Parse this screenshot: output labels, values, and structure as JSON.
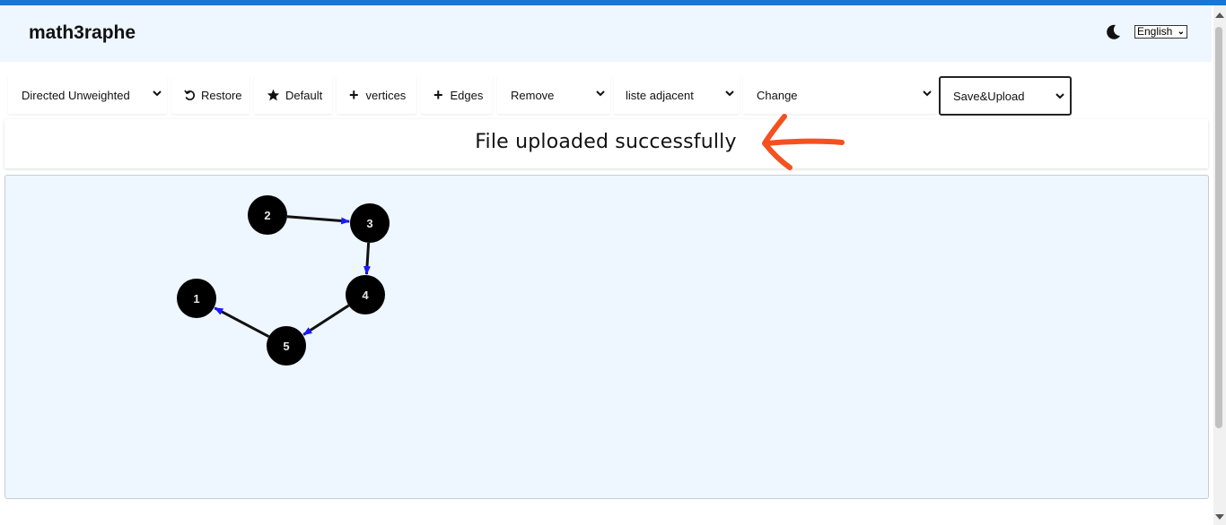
{
  "header": {
    "title": "math3raphe",
    "theme_icon": "moon-icon",
    "language": "English"
  },
  "toolbar": {
    "graph_type": "Directed Unweighted",
    "restore_label": "Restore",
    "default_label": "Default",
    "vertices_label": "vertices",
    "edges_label": "Edges",
    "remove_label": "Remove",
    "representation": "liste adjacent",
    "change_label": "Change",
    "save_label": "Save&Upload"
  },
  "message": {
    "text": "File uploaded successfully"
  },
  "graph": {
    "nodes": [
      {
        "id": "1",
        "label": "1"
      },
      {
        "id": "2",
        "label": "2"
      },
      {
        "id": "3",
        "label": "3"
      },
      {
        "id": "4",
        "label": "4"
      },
      {
        "id": "5",
        "label": "5"
      }
    ],
    "edges": [
      {
        "from": "2",
        "to": "3"
      },
      {
        "from": "3",
        "to": "4"
      },
      {
        "from": "4",
        "to": "5"
      },
      {
        "from": "5",
        "to": "1"
      }
    ],
    "node_color": "#000000",
    "edge_color": "#111111",
    "arrow_color": "#1a1aff"
  },
  "colors": {
    "accent_bar": "#1976d2",
    "header_bg": "#eef6ff",
    "annotation_arrow": "#f4511e"
  }
}
